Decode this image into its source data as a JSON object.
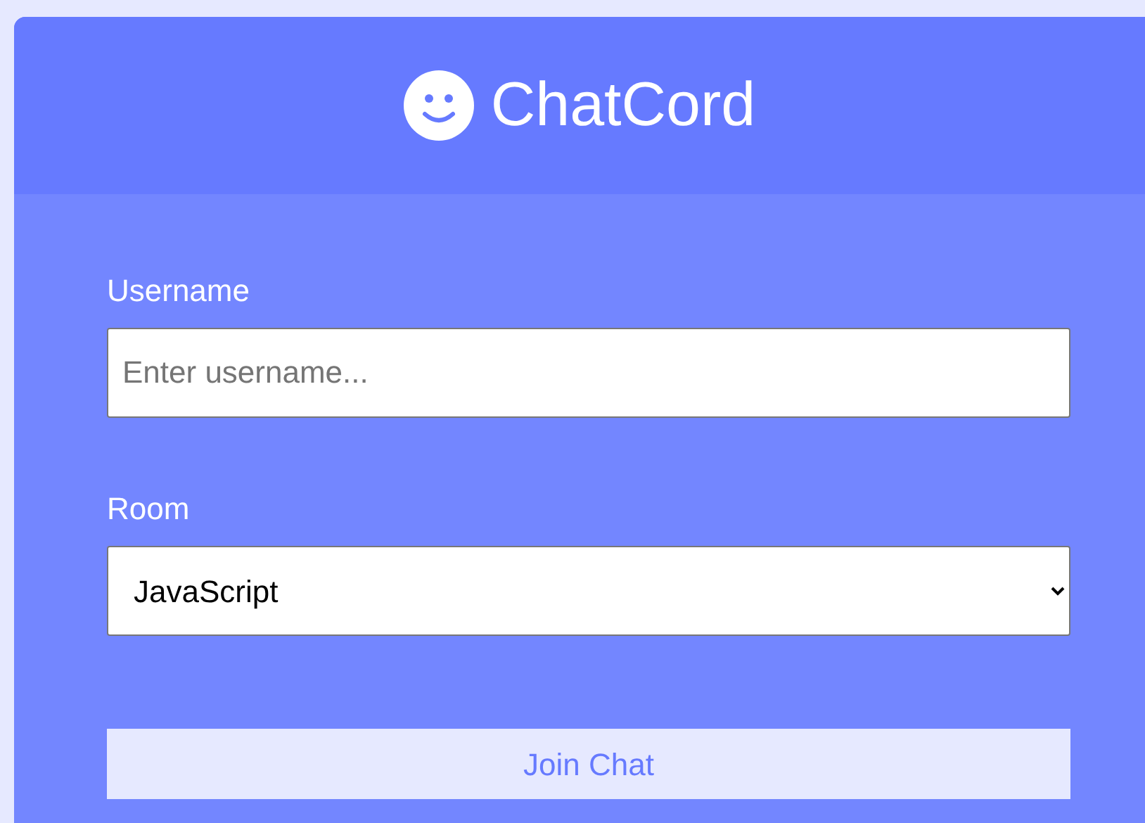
{
  "header": {
    "title": "ChatCord"
  },
  "form": {
    "fields": [
      {
        "kind": "text",
        "label": "Username",
        "placeholder": "Enter username..."
      },
      {
        "kind": "select",
        "label": "Room",
        "value": "JavaScript"
      }
    ],
    "submit": "Join Chat"
  }
}
